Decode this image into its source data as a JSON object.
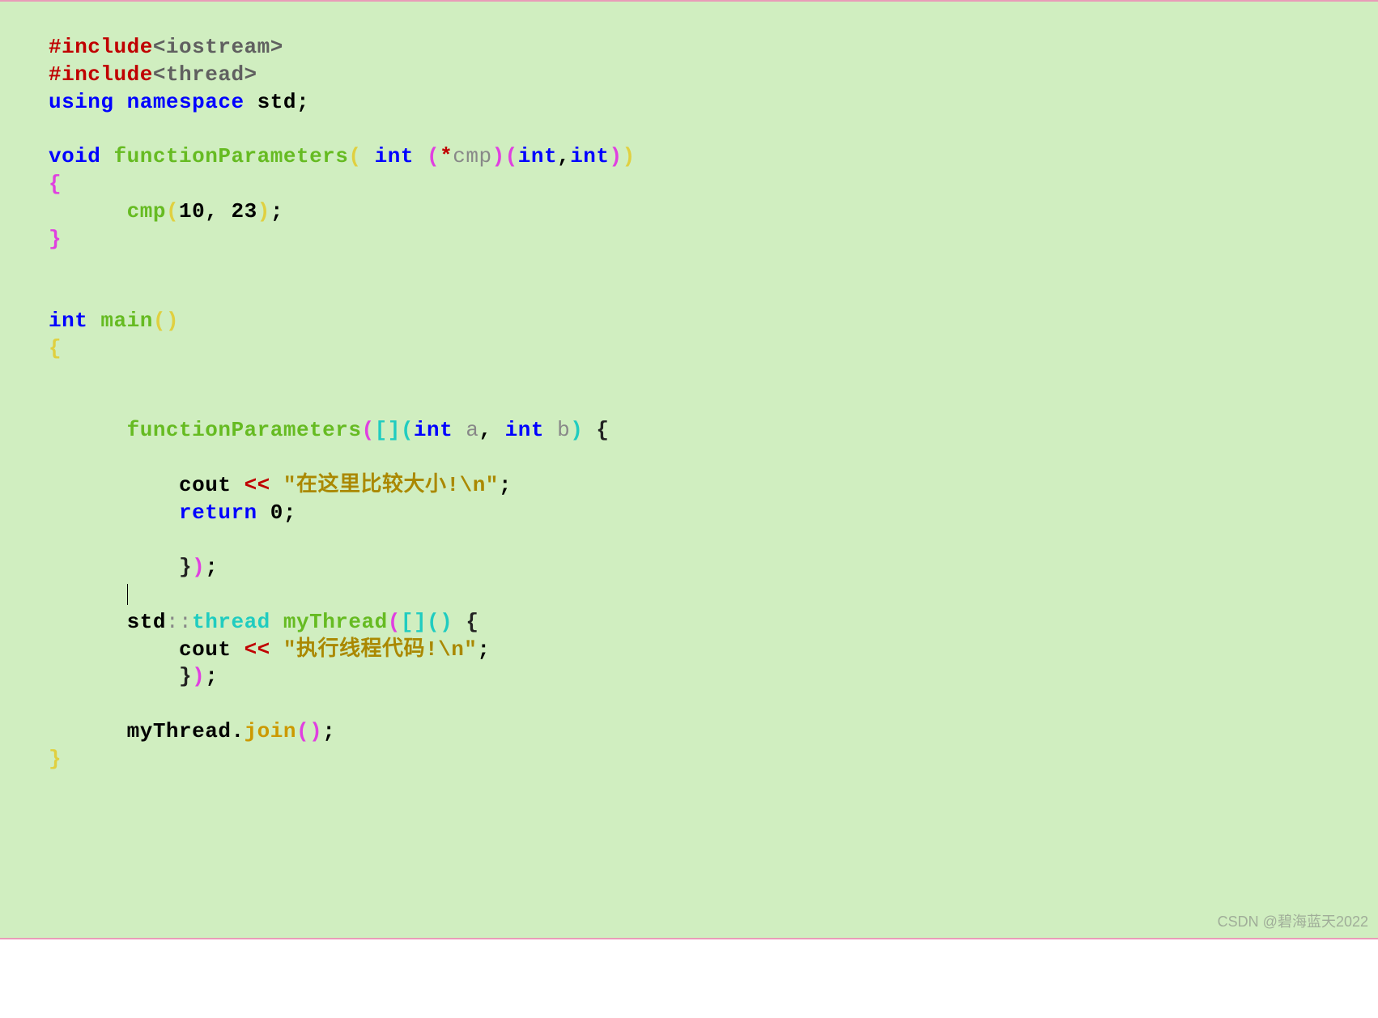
{
  "code": {
    "include1_pre": "#include",
    "include1_hdr": "<iostream>",
    "include2_pre": "#include",
    "include2_hdr": "<thread>",
    "using_kw": "using",
    "namespace_kw": "namespace",
    "std_ident": "std",
    "void_kw": "void",
    "functionParameters": "functionParameters",
    "int_kw": "int",
    "cmp_ident": "cmp",
    "num10": "10",
    "num23": "23",
    "main_ident": "main",
    "a_ident": "a",
    "b_ident": "b",
    "cout_ident": "cout",
    "string_compare": "\"在这里比较大小!\\n\"",
    "return_kw": "return",
    "zero": "0",
    "std2_ident": "std",
    "thread_type": "thread",
    "myThread_ident": "myThread",
    "string_exec": "\"执行线程代码!\\n\"",
    "join_method": "join"
  },
  "watermark": "CSDN @碧海蓝天2022"
}
